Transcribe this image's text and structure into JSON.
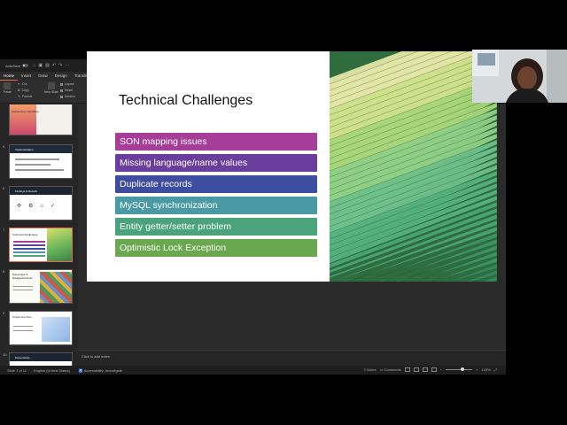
{
  "titlebar": {
    "autosave_label": "AutoSave",
    "doc_title": "DIY API Project",
    "saved_status": "— Saved to my Mac ⌄",
    "search_placeholder": "Search (Cmd + Ctrl + U)"
  },
  "ribbon_tabs": [
    "Home",
    "Insert",
    "Draw",
    "Design",
    "Transitions",
    "Animations",
    "Slide Show",
    "Record",
    "Review",
    "View"
  ],
  "comments_label": "Comments",
  "ribbon": {
    "paste": "Paste",
    "cut": "Cut",
    "copy": "Copy",
    "format": "Format",
    "new_slide": "New Slide",
    "layout": "Layout",
    "reset": "Reset",
    "section": "Section",
    "convert": "Convert to SmartArt",
    "picture": "Picture",
    "shapes": "Shapes",
    "textbox": "Text Box",
    "arrange": "Arrange",
    "quick_styles": "Quick Styles",
    "shape_fill": "Shape Fill",
    "shape_outline": "Shape Outline",
    "sensitivity": "Sensitivity",
    "addins": "Add-ins",
    "designer": "Designer"
  },
  "thumbnails": [
    {
      "num": "",
      "title": "Architecture / Workflow"
    },
    {
      "num": "5",
      "title": "Implementation"
    },
    {
      "num": "6",
      "title": "Findings & Results"
    },
    {
      "num": "7",
      "title": "Technical Challenges"
    },
    {
      "num": "8",
      "title": "Successes & Disappointments"
    },
    {
      "num": "9",
      "title": "Project Go-Over"
    },
    {
      "num": "10",
      "title": "Screenshots"
    }
  ],
  "slide": {
    "title": "Technical Challenges",
    "bullets": [
      {
        "text": "SON mapping issues",
        "color": "#a63d98"
      },
      {
        "text": "Missing language/name values",
        "color": "#6a3e9c"
      },
      {
        "text": "Duplicate records",
        "color": "#3f4da0"
      },
      {
        "text": "MySQL synchronization",
        "color": "#4a9aa6"
      },
      {
        "text": "Entity getter/setter problem",
        "color": "#4aa37a"
      },
      {
        "text": "Optimistic Lock Exception",
        "color": "#6aa84f"
      }
    ]
  },
  "notes_placeholder": "Click to add notes",
  "status": {
    "slide_of": "Slide 7 of 11",
    "language": "English (United States)",
    "accessibility": "Accessibility: Investigate",
    "notes": "Notes",
    "comments": "Comments",
    "zoom": "143%"
  },
  "colors": {
    "accent": "#e86b4d",
    "app_bg": "#2b2b2b"
  }
}
